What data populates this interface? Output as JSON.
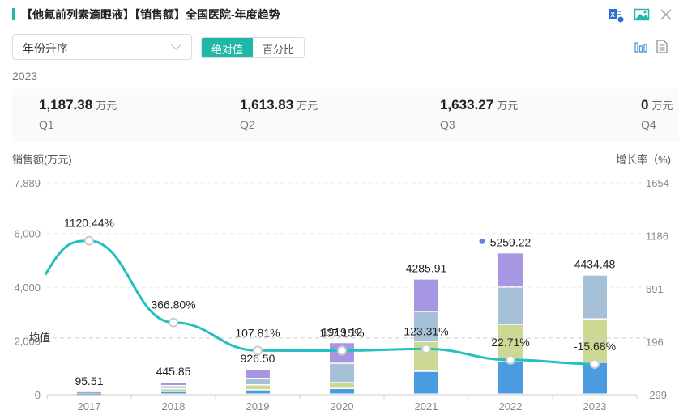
{
  "header": {
    "title": "【他氟前列素滴眼液】【销售额】全国医院-年度趋势",
    "icons": [
      "excel-export-icon",
      "image-export-icon",
      "close-icon"
    ]
  },
  "toolbar": {
    "sort_select": "年份升序",
    "toggle": [
      {
        "label": "绝对值",
        "active": true
      },
      {
        "label": "百分比",
        "active": false
      }
    ],
    "view_icons": [
      "bar-chart-icon",
      "document-icon"
    ]
  },
  "summary": {
    "year": "2023",
    "quarters": [
      {
        "value": "1,187.38",
        "unit": "万元",
        "label": "Q1"
      },
      {
        "value": "1,613.83",
        "unit": "万元",
        "label": "Q2"
      },
      {
        "value": "1,633.27",
        "unit": "万元",
        "label": "Q3"
      },
      {
        "value": "0",
        "unit": "万元",
        "label": "Q4"
      }
    ]
  },
  "colors": {
    "accent": "#1fb8a8",
    "q1": "#4a9be0",
    "q2": "#ccd994",
    "q3": "#a6c0d8",
    "q4": "#a797e3",
    "growth": "#25bfbf"
  },
  "chart_data": {
    "type": "bar",
    "stacked": true,
    "ylabel": "销售额(万元)",
    "y2label": "增长率（%)",
    "ylim": [
      0,
      7889
    ],
    "y2lim": [
      -299,
      1654
    ],
    "yticks": [
      "0",
      "2,000",
      "4,000",
      "6,000",
      "7,889"
    ],
    "y2ticks": [
      "-299",
      "196",
      "691",
      "1186",
      "1654"
    ],
    "categories": [
      "2017",
      "2018",
      "2019",
      "2020",
      "2021",
      "2022",
      "2023"
    ],
    "series": [
      {
        "values": [
          24,
          100,
          160,
          210,
          850,
          1240,
          1187.38
        ]
      },
      {
        "values": [
          24,
          105,
          185,
          220,
          1115,
          1360,
          1613.83
        ]
      },
      {
        "values": [
          24,
          110,
          240,
          720,
          1115,
          1385,
          1633.27
        ]
      },
      {
        "values": [
          23.51,
          130.85,
          341.5,
          769.2,
          1205.91,
          1274.22,
          0
        ]
      }
    ],
    "totals": [
      "95.51",
      "445.85",
      "926.50",
      "1919.12",
      "4285.91",
      "5259.22",
      "4434.48"
    ],
    "growth": [
      1120.44,
      366.8,
      107.81,
      107.15,
      123.31,
      22.71,
      -15.68
    ],
    "growth_labels": [
      "1120.44%",
      "366.80%",
      "107.81%",
      "107.15%",
      "123.31%",
      "22.71%",
      "-15.68%"
    ],
    "mean_label": "均值",
    "mean_value": 2110,
    "grid": true
  }
}
